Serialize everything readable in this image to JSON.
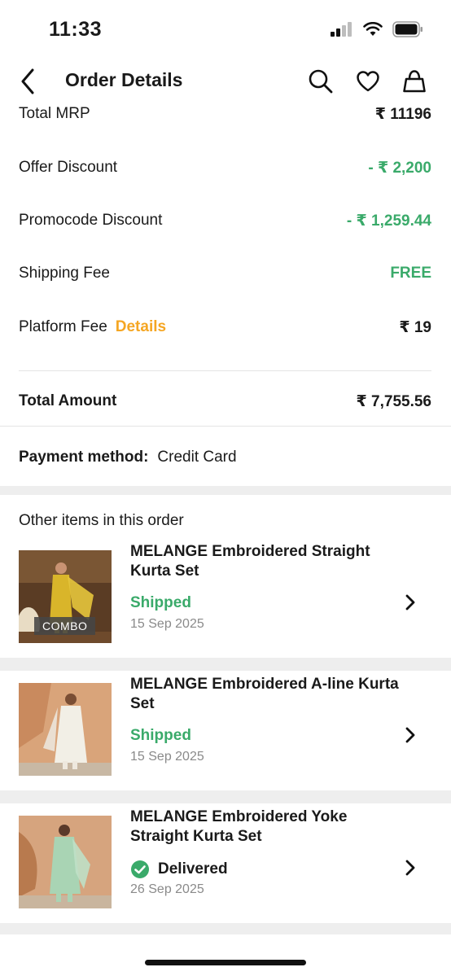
{
  "status_bar": {
    "time": "11:33"
  },
  "header": {
    "title": "Order Details"
  },
  "price_details": {
    "total_mrp_label": "Total MRP",
    "total_mrp_value": "₹ 11196",
    "offer_discount_label": "Offer Discount",
    "offer_discount_value": "- ₹ 2,200",
    "promocode_discount_label": "Promocode Discount",
    "promocode_discount_value": "- ₹ 1,259.44",
    "shipping_fee_label": "Shipping Fee",
    "shipping_fee_value": "FREE",
    "platform_fee_label": "Platform Fee",
    "platform_fee_link": "Details",
    "platform_fee_value": "₹ 19",
    "total_amount_label": "Total Amount",
    "total_amount_value": "₹ 7,755.56"
  },
  "payment": {
    "label": "Payment method:",
    "value": "Credit Card"
  },
  "other_items": {
    "title": "Other items in this order",
    "items": [
      {
        "name": "MELANGE Embroidered Straight Kurta Set",
        "status": "Shipped",
        "date": "15 Sep 2025",
        "badge": "COMBO"
      },
      {
        "name": "MELANGE Embroidered A-line Kurta Set",
        "status": "Shipped",
        "date": "15 Sep 2025"
      },
      {
        "name": "MELANGE Embroidered Yoke Straight Kurta Set",
        "status": "Delivered",
        "date": "26 Sep 2025"
      }
    ]
  },
  "colors": {
    "green": "#3aaa6a",
    "orange": "#f5a623",
    "muted": "#8a8a8a"
  },
  "icons": [
    "back-icon",
    "search-icon",
    "heart-icon",
    "bag-icon",
    "chevron-right-icon",
    "check-circle-icon"
  ]
}
